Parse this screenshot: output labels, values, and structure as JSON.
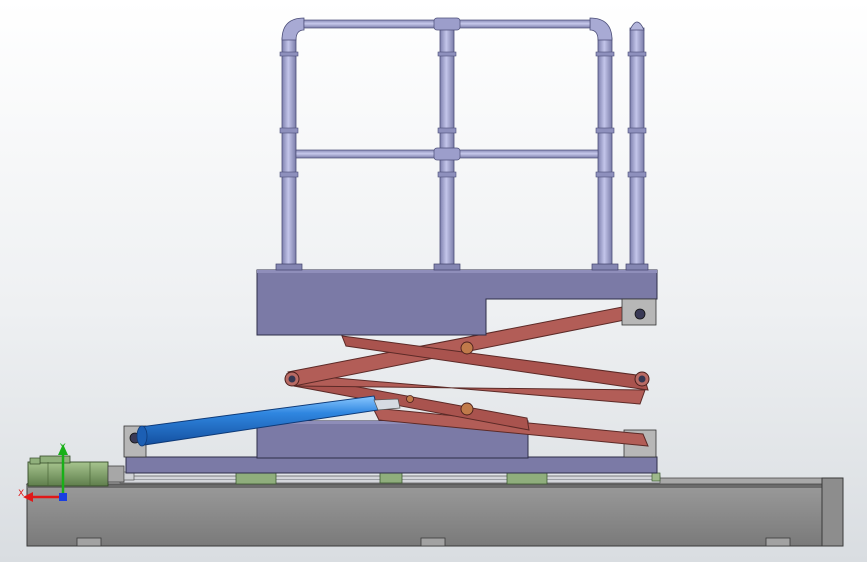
{
  "viewport": {
    "background": "#e6e9ec"
  },
  "model": {
    "description_none": "",
    "colors": {
      "base": "#8a8a8a",
      "base_dark": "#5e5e5e",
      "platform": "#7b7aa6",
      "platform_dark": "#56557c",
      "scissor": "#b25d57",
      "scissor_dark": "#7a3a36",
      "railing": "#9d9ec8",
      "railing_dark": "#6a6b96",
      "cylinder": "#2a78d4",
      "cylinder_light": "#6cb4ff",
      "motor": "#7f9e6a",
      "rail": "#c9ccd2"
    },
    "parts": [
      {
        "name": "base-frame"
      },
      {
        "name": "linear-rail"
      },
      {
        "name": "drive-motor"
      },
      {
        "name": "lower-platform"
      },
      {
        "name": "scissor-arms"
      },
      {
        "name": "hydraulic-cylinder"
      },
      {
        "name": "upper-platform"
      },
      {
        "name": "guard-railing"
      }
    ]
  },
  "triad": {
    "x_label": "X",
    "y_label": "Y",
    "x_color": "#e01818",
    "y_color": "#18b018",
    "z_color": "#1a3fe0"
  }
}
